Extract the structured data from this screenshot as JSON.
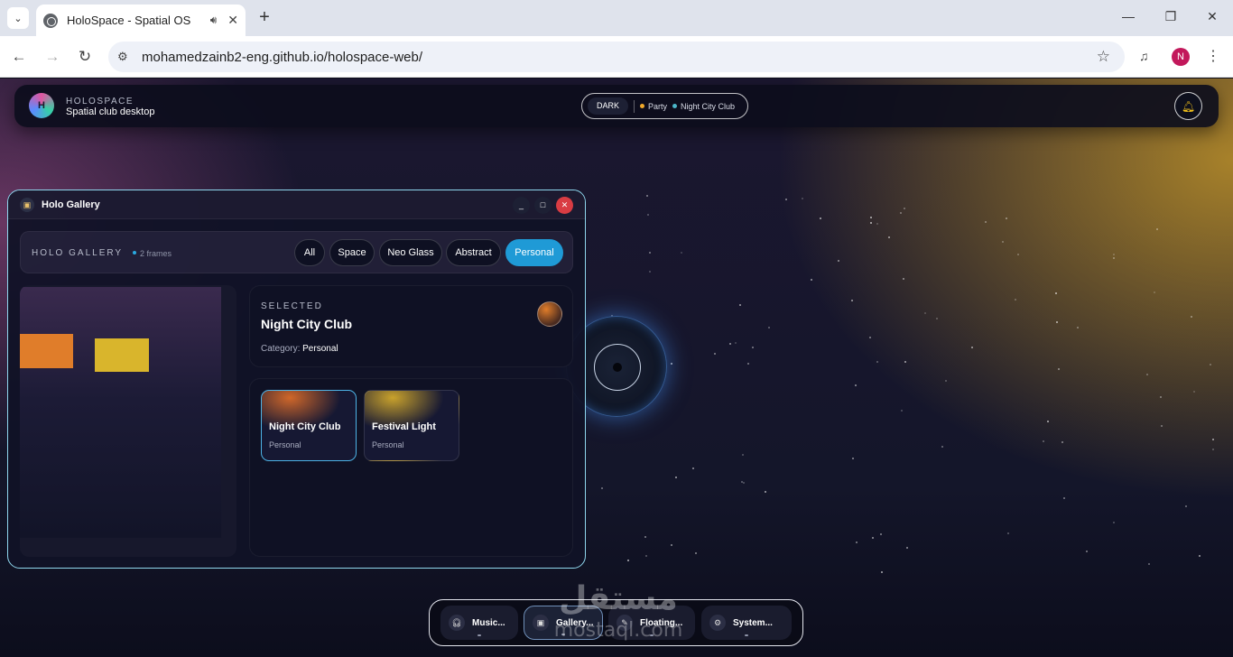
{
  "browser": {
    "tab_title": "HoloSpace - Spatial OS",
    "url": "mohamedzainb2-eng.github.io/holospace-web/",
    "profile_initial": "N"
  },
  "topbar": {
    "brand_initial": "H",
    "brand_name": "HOLOSPACE",
    "brand_subtitle": "Spatial club desktop",
    "mode": "DARK",
    "status": [
      {
        "label": "Party",
        "color": "#f0a92b"
      },
      {
        "label": "Night City Club",
        "color": "#4bb6c9"
      }
    ]
  },
  "window": {
    "title": "Holo Gallery",
    "gallery_title": "HOLO GALLERY",
    "frame_count": "2 frames",
    "filters": [
      "All",
      "Space",
      "Neo Glass",
      "Abstract",
      "Personal"
    ],
    "active_filter": "Personal",
    "selected": {
      "label": "SELECTED",
      "name": "Night City Club",
      "category_label": "Category:",
      "category": "Personal"
    },
    "items": [
      {
        "name": "Night City Club",
        "category": "Personal",
        "selected": true
      },
      {
        "name": "Festival Light",
        "category": "Personal",
        "selected": false
      }
    ]
  },
  "dock": {
    "items": [
      {
        "label": "Music...",
        "icon": "headphones-icon",
        "active": false
      },
      {
        "label": "Gallery...",
        "icon": "gallery-icon",
        "active": true
      },
      {
        "label": "Floating...",
        "icon": "note-icon",
        "active": false
      },
      {
        "label": "System...",
        "icon": "gear-icon",
        "active": false
      }
    ]
  },
  "watermark": {
    "arabic": "مستقل",
    "latin": "mostaql.com"
  },
  "colors": {
    "accent": "#1f9ad6",
    "window_border": "#8fd7ee",
    "close_button": "#d93c43",
    "bell": "#f5c31b"
  }
}
